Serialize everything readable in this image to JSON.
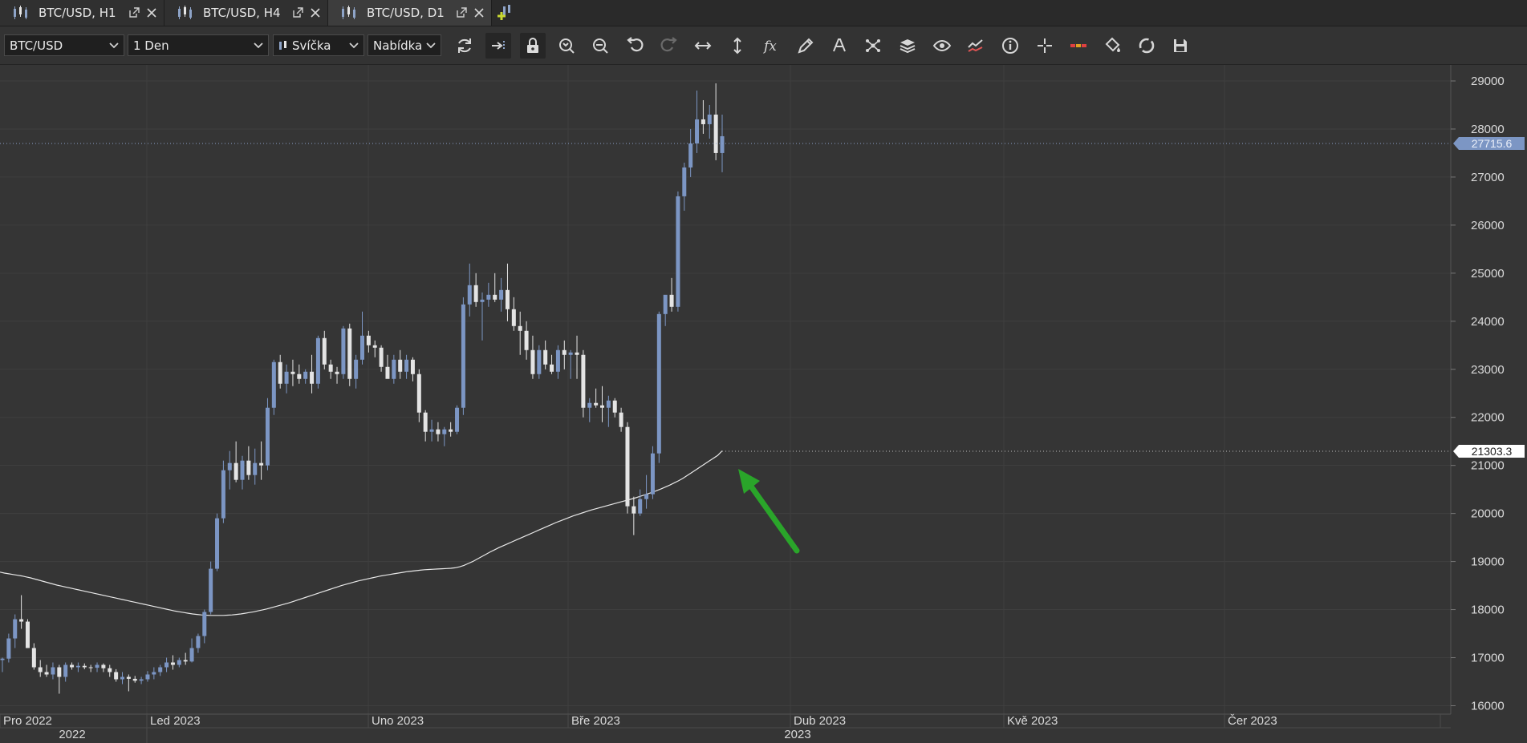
{
  "tabs": [
    {
      "label": "BTC/USD, H1",
      "active": false
    },
    {
      "label": "BTC/USD, H4",
      "active": false
    },
    {
      "label": "BTC/USD, D1",
      "active": true
    }
  ],
  "toolbar": {
    "symbol": "BTC/USD",
    "timeframe": "1 Den",
    "chart_style": "Svíčka",
    "price_type": "Nabídka",
    "icons": [
      "refresh-icon",
      "autoscroll-icon",
      "lock-icon",
      "zoom-in-icon",
      "zoom-out-icon",
      "undo-icon",
      "redo-icon",
      "horizontal-scale-icon",
      "vertical-scale-icon",
      "indicators-fx-icon",
      "draw-pencil-icon",
      "text-tool-icon",
      "object-tree-icon",
      "layers-icon",
      "visibility-eye-icon",
      "compare-icon",
      "info-icon",
      "crosshair-icon",
      "trade-levels-icon",
      "fill-color-icon",
      "sync-icon",
      "save-icon"
    ]
  },
  "chart_data": {
    "type": "candlestick",
    "symbol": "BTC/USD",
    "timeframe": "D1",
    "y_axis": {
      "min": 16000,
      "max": 29000,
      "ticks": [
        16000,
        17000,
        18000,
        19000,
        20000,
        21000,
        22000,
        23000,
        24000,
        25000,
        26000,
        27000,
        28000,
        29000
      ]
    },
    "x_axis": {
      "month_labels": [
        "Pro 2022",
        "Led 2023",
        "Uno 2023",
        "Bře 2023",
        "Dub 2023",
        "Kvě 2023",
        "Čer 2023"
      ],
      "year_labels": [
        "2022",
        "2023"
      ]
    },
    "price_labels": {
      "last": "27715.6",
      "ma": "21303.3"
    },
    "candles": [
      [
        16950,
        17000,
        16700,
        16980
      ],
      [
        16980,
        17500,
        16900,
        17400
      ],
      [
        17400,
        17900,
        17200,
        17800
      ],
      [
        17800,
        18300,
        17600,
        17750
      ],
      [
        17750,
        17800,
        17200,
        17200
      ],
      [
        17200,
        17300,
        16750,
        16800
      ],
      [
        16800,
        16950,
        16600,
        16700
      ],
      [
        16700,
        16850,
        16600,
        16650
      ],
      [
        16650,
        16900,
        16550,
        16800
      ],
      [
        16800,
        16850,
        16250,
        16600
      ],
      [
        16600,
        16900,
        16500,
        16850
      ],
      [
        16850,
        16900,
        16750,
        16800
      ],
      [
        16800,
        16900,
        16700,
        16830
      ],
      [
        16830,
        16880,
        16760,
        16800
      ],
      [
        16800,
        16850,
        16700,
        16790
      ],
      [
        16790,
        16900,
        16700,
        16850
      ],
      [
        16850,
        16880,
        16700,
        16780
      ],
      [
        16780,
        16850,
        16600,
        16700
      ],
      [
        16700,
        16760,
        16500,
        16550
      ],
      [
        16550,
        16700,
        16450,
        16600
      ],
      [
        16600,
        16650,
        16300,
        16560
      ],
      [
        16560,
        16620,
        16480,
        16520
      ],
      [
        16520,
        16600,
        16450,
        16550
      ],
      [
        16550,
        16720,
        16500,
        16650
      ],
      [
        16650,
        16800,
        16550,
        16700
      ],
      [
        16700,
        16850,
        16620,
        16800
      ],
      [
        16800,
        17000,
        16700,
        16900
      ],
      [
        16900,
        17050,
        16750,
        16850
      ],
      [
        16850,
        17000,
        16800,
        16950
      ],
      [
        16950,
        17100,
        16850,
        16920
      ],
      [
        16920,
        17400,
        16900,
        17200
      ],
      [
        17200,
        17500,
        17100,
        17450
      ],
      [
        17450,
        18000,
        17300,
        17950
      ],
      [
        17950,
        19000,
        17900,
        18850
      ],
      [
        18850,
        20000,
        18800,
        19900
      ],
      [
        19900,
        21100,
        19800,
        20900
      ],
      [
        20900,
        21300,
        20500,
        21050
      ],
      [
        21050,
        21500,
        20650,
        20700
      ],
      [
        20700,
        21200,
        20500,
        21100
      ],
      [
        21100,
        21400,
        20700,
        20800
      ],
      [
        20800,
        21350,
        20600,
        21050
      ],
      [
        21050,
        21500,
        20700,
        21000
      ],
      [
        21000,
        22400,
        20900,
        22200
      ],
      [
        22200,
        23200,
        22050,
        23150
      ],
      [
        23150,
        23300,
        22600,
        22700
      ],
      [
        22700,
        23100,
        22500,
        22950
      ],
      [
        22950,
        23200,
        22650,
        22900
      ],
      [
        22900,
        23100,
        22700,
        22800
      ],
      [
        22800,
        23000,
        22700,
        22950
      ],
      [
        22950,
        23300,
        22500,
        22700
      ],
      [
        22700,
        23700,
        22600,
        23650
      ],
      [
        23650,
        23800,
        23000,
        23100
      ],
      [
        23100,
        23200,
        22800,
        22950
      ],
      [
        22950,
        23050,
        22700,
        22900
      ],
      [
        22900,
        23900,
        22800,
        23850
      ],
      [
        23850,
        23950,
        22650,
        22800
      ],
      [
        22800,
        23300,
        22600,
        23200
      ],
      [
        23200,
        24200,
        23100,
        23700
      ],
      [
        23700,
        23800,
        23350,
        23500
      ],
      [
        23500,
        23600,
        23250,
        23450
      ],
      [
        23450,
        23500,
        22950,
        23050
      ],
      [
        23050,
        23300,
        22850,
        22800
      ],
      [
        22800,
        23300,
        22700,
        23200
      ],
      [
        23200,
        23400,
        22800,
        22950
      ],
      [
        22950,
        23300,
        22800,
        23200
      ],
      [
        23200,
        23250,
        22750,
        22900
      ],
      [
        22900,
        23000,
        21900,
        22100
      ],
      [
        22100,
        22150,
        21500,
        21700
      ],
      [
        21700,
        21950,
        21500,
        21750
      ],
      [
        21750,
        21900,
        21500,
        21650
      ],
      [
        21650,
        21800,
        21400,
        21750
      ],
      [
        21750,
        21900,
        21600,
        21700
      ],
      [
        21700,
        22250,
        21650,
        22200
      ],
      [
        22200,
        24500,
        22050,
        24350
      ],
      [
        24350,
        25200,
        24100,
        24750
      ],
      [
        24750,
        25000,
        24300,
        24400
      ],
      [
        24400,
        24600,
        23600,
        24450
      ],
      [
        24450,
        24800,
        24300,
        24550
      ],
      [
        24550,
        25000,
        24400,
        24450
      ],
      [
        24450,
        24900,
        24200,
        24650
      ],
      [
        24650,
        25200,
        24000,
        24250
      ],
      [
        24250,
        24500,
        23800,
        23900
      ],
      [
        23900,
        24200,
        23300,
        23800
      ],
      [
        23800,
        24000,
        23200,
        23400
      ],
      [
        23400,
        23700,
        22800,
        22900
      ],
      [
        22900,
        23500,
        22800,
        23400
      ],
      [
        23400,
        23600,
        23000,
        23100
      ],
      [
        23100,
        23300,
        22900,
        22950
      ],
      [
        22950,
        23500,
        22800,
        23400
      ],
      [
        23400,
        23600,
        23000,
        23300
      ],
      [
        23300,
        23400,
        22800,
        23350
      ],
      [
        23350,
        23700,
        22800,
        23300
      ],
      [
        23300,
        23400,
        22000,
        22200
      ],
      [
        22200,
        22400,
        21900,
        22300
      ],
      [
        22300,
        22600,
        22200,
        22250
      ],
      [
        22250,
        22650,
        21900,
        22200
      ],
      [
        22200,
        22450,
        21800,
        22350
      ],
      [
        22350,
        22400,
        22000,
        22100
      ],
      [
        22100,
        22200,
        21700,
        21800
      ],
      [
        21800,
        21900,
        20000,
        20150
      ],
      [
        20150,
        20350,
        19550,
        20000
      ],
      [
        20000,
        20500,
        19950,
        20300
      ],
      [
        20300,
        20800,
        20100,
        20400
      ],
      [
        20400,
        21400,
        20300,
        21250
      ],
      [
        21250,
        24200,
        21050,
        24150
      ],
      [
        24150,
        24500,
        23900,
        24550
      ],
      [
        24550,
        24900,
        24200,
        24300
      ],
      [
        24300,
        26700,
        24200,
        26600
      ],
      [
        26600,
        27300,
        26300,
        27200
      ],
      [
        27200,
        28000,
        27000,
        27700
      ],
      [
        27700,
        28800,
        27500,
        28200
      ],
      [
        28200,
        28600,
        27900,
        28100
      ],
      [
        28100,
        28500,
        27800,
        28300
      ],
      [
        28300,
        28950,
        27350,
        27500
      ],
      [
        27500,
        28300,
        27100,
        27850
      ]
    ],
    "moving_average": [
      18780,
      18760,
      18745,
      18730,
      18715,
      18700,
      18680,
      18660,
      18635,
      18610,
      18585,
      18560,
      18535,
      18510,
      18490,
      18470,
      18450,
      18430,
      18410,
      18390,
      18370,
      18350,
      18330,
      18310,
      18290,
      18270,
      18250,
      18230,
      18210,
      18190,
      18170,
      18150,
      18130,
      18110,
      18090,
      18070,
      18050,
      18030,
      18010,
      17990,
      17970,
      17955,
      17940,
      17925,
      17910,
      17900,
      17890,
      17885,
      17880,
      17880,
      17880,
      17880,
      17885,
      17890,
      17900,
      17910,
      17925,
      17940,
      17955,
      17975,
      17995,
      18015,
      18040,
      18065,
      18090,
      18115,
      18140,
      18170,
      18200,
      18230,
      18260,
      18290,
      18320,
      18350,
      18380,
      18410,
      18440,
      18470,
      18500,
      18525,
      18550,
      18575,
      18600,
      18620,
      18640,
      18660,
      18680,
      18700,
      18715,
      18730,
      18745,
      18760,
      18775,
      18790,
      18800,
      18810,
      18820,
      18830,
      18835,
      18840,
      18845,
      18850,
      18855,
      18860,
      18870,
      18890,
      18920,
      18960,
      19000,
      19050,
      19100,
      19150,
      19200,
      19245,
      19290,
      19330,
      19370,
      19410,
      19450,
      19490,
      19530,
      19570,
      19610,
      19650,
      19690,
      19730,
      19770,
      19810,
      19845,
      19880,
      19915,
      19950,
      19980,
      20010,
      20040,
      20070,
      20095,
      20120,
      20145,
      20170,
      20195,
      20220,
      20245,
      20270,
      20295,
      20320,
      20350,
      20380,
      20410,
      20440,
      20475,
      20510,
      20550,
      20590,
      20635,
      20680,
      20730,
      20790,
      20850,
      20910,
      20970,
      21030,
      21090,
      21150,
      21210,
      21303
    ]
  }
}
